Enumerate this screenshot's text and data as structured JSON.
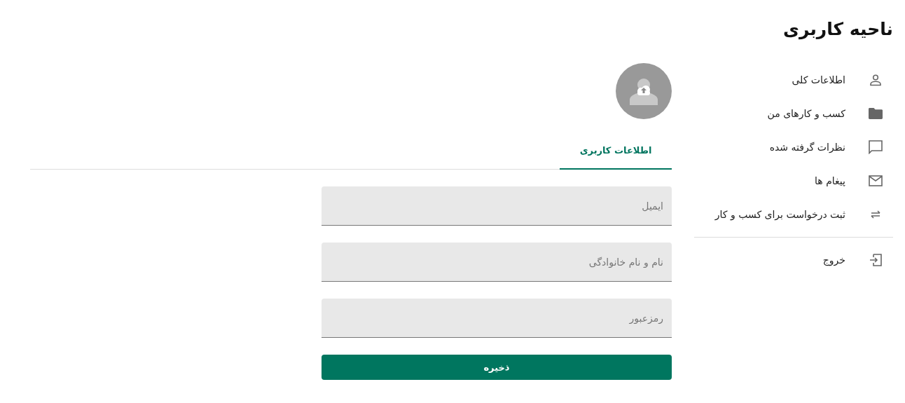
{
  "sidebar": {
    "title": "ناحیه کاربری",
    "items": [
      {
        "label": "اطلاعات کلی"
      },
      {
        "label": "کسب و کارهای من"
      },
      {
        "label": "نظرات گرفته شده"
      },
      {
        "label": "پیغام ها"
      },
      {
        "label": "ثبت درخواست برای کسب و کار"
      }
    ],
    "footer_items": [
      {
        "label": "خروج"
      }
    ]
  },
  "tabs": [
    {
      "label": "اطلاعات کاربری",
      "selected": true
    }
  ],
  "form": {
    "fields": [
      {
        "placeholder": "ایمیل"
      },
      {
        "placeholder": "نام و نام خانوادگی"
      },
      {
        "placeholder": "رمزعبور"
      }
    ],
    "save_button": "ذخیره"
  }
}
